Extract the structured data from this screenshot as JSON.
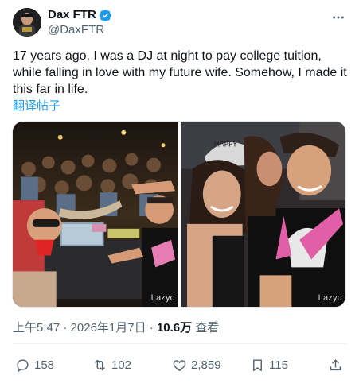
{
  "author": {
    "display_name": "Dax FTR",
    "handle": "@DaxFTR",
    "verified_color": "#1d9bf0"
  },
  "tweet": {
    "text": "17 years ago, I was a DJ at night to pay college tuition, while falling in love with my future wife. Somehow, I made it this far in life.",
    "translate_label": "翻译帖子"
  },
  "media": {
    "watermark_left": "Lazyd",
    "watermark_right": "Lazyd"
  },
  "meta": {
    "time": "上午5:47",
    "separator": "·",
    "date": "2026年1月7日",
    "views_count": "10.6万",
    "views_label": "查看"
  },
  "actions": {
    "replies": "158",
    "retweets": "102",
    "likes": "2,859",
    "bookmarks": "115"
  },
  "colors": {
    "accent": "#1d9bf0",
    "text_primary": "#0f1419",
    "text_secondary": "#536471"
  }
}
